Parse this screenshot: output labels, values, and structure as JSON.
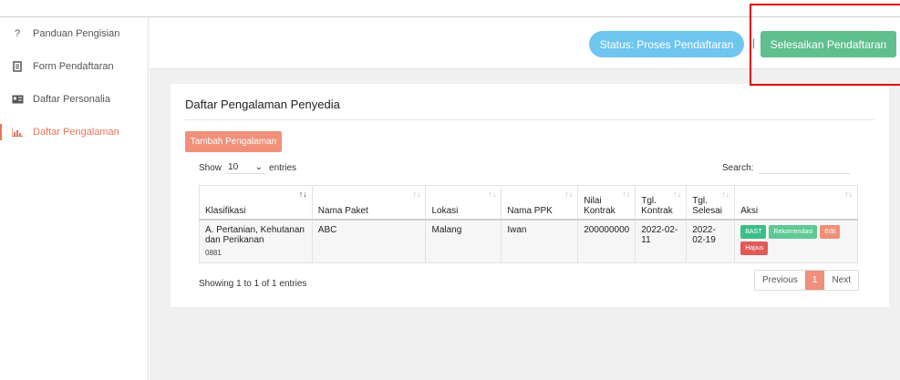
{
  "sidebar": {
    "items": [
      {
        "label": "Panduan Pengisian",
        "icon": "question-icon"
      },
      {
        "label": "Form Pendaftaran",
        "icon": "clipboard-icon"
      },
      {
        "label": "Daftar Personalia",
        "icon": "id-card-icon"
      },
      {
        "label": "Daftar Pengalaman",
        "icon": "chart-icon",
        "active": true
      }
    ]
  },
  "header": {
    "status_label": "Status: Proses Pendaftaran",
    "separator": "|",
    "finish_label": "Selesaikan Pendaftaran"
  },
  "card": {
    "title": "Daftar Pengalaman Penyedia",
    "add_label": "Tambah Pengalaman",
    "show_label": "Show",
    "entries_value": "10",
    "entries_label": "entries",
    "search_label": "Search:",
    "search_value": ""
  },
  "table": {
    "headers": [
      "Klasifikasi",
      "Nama Paket",
      "Lokasi",
      "Nama PPK",
      "Nilai Kontrak",
      "Tgl. Kontrak",
      "Tgl. Selesai",
      "Aksi"
    ],
    "rows": [
      {
        "klasifikasi": "A. Pertanian, Kehutanan dan Perikanan",
        "kode": "0881",
        "nama_paket": "ABC",
        "lokasi": "Malang",
        "nama_ppk": "Iwan",
        "nilai_kontrak": "200000000",
        "tgl_kontrak": "2022-02-11",
        "tgl_selesai": "2022-02-19",
        "actions": {
          "bast": "BAST",
          "rekomendasi": "Rekomendasi",
          "edit": "Edit",
          "hapus": "Hapus"
        }
      }
    ]
  },
  "footer": {
    "info": "Showing 1 to 1 of 1 entries",
    "previous": "Previous",
    "page": "1",
    "next": "Next"
  },
  "colors": {
    "accent": "#e8765a",
    "status": "#6ec6ee",
    "finish": "#5fbf8e",
    "highlight_box": "#e00000"
  }
}
